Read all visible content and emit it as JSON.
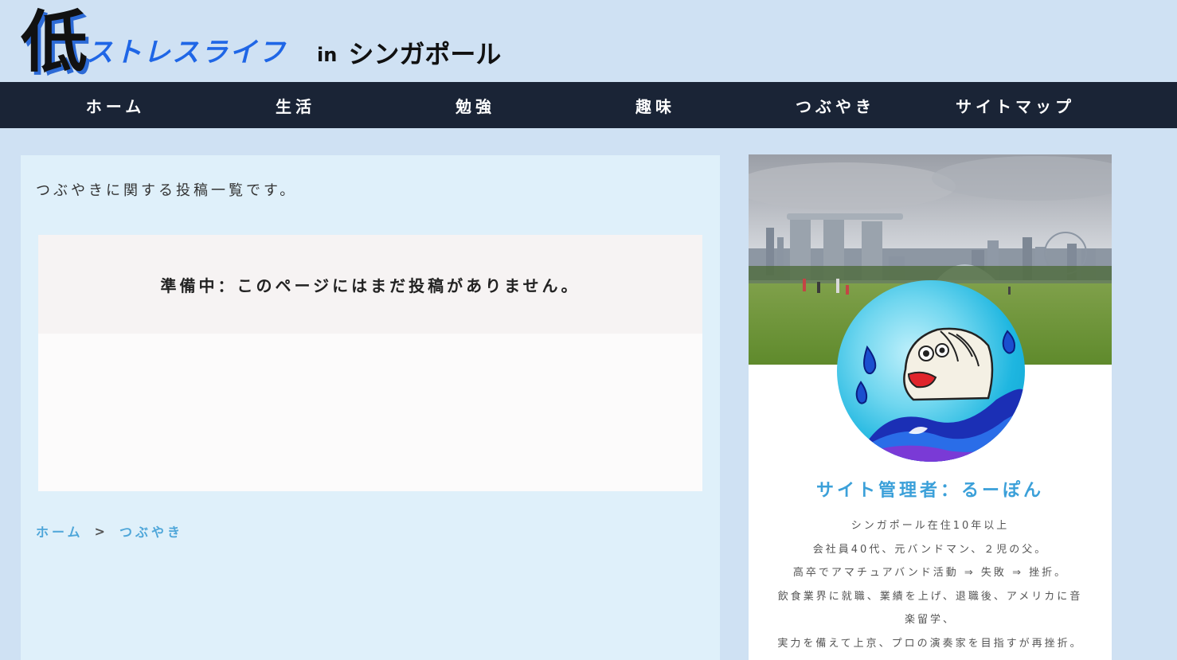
{
  "site": {
    "logo_kanji": "低",
    "logo_main": "ストレスライフ",
    "logo_in": "in",
    "logo_place": "シンガポール"
  },
  "nav": {
    "items": [
      "ホーム",
      "生活",
      "勉強",
      "趣味",
      "つぶやき",
      "サイトマップ"
    ]
  },
  "main": {
    "intro": "つぶやきに関する投稿一覧です。",
    "notice": "準備中：このページにはまだ投稿がありません。"
  },
  "breadcrumb": {
    "home": "ホーム",
    "sep": ">",
    "current": "つぶやき"
  },
  "sidebar": {
    "admin_name": "サイト管理者：るーぽん",
    "bio": [
      "シンガポール在住10年以上",
      "会社員40代、元バンドマン、２児の父。",
      "高卒でアマチュアバンド活動 ⇒ 失敗 ⇒ 挫折。",
      "飲食業界に就職、業績を上げ、退職後、アメリカに音",
      "楽留学、",
      "実力を備えて上京、プロの演奏家を目指すが再挫折。"
    ]
  },
  "colors": {
    "background": "#cfe1f3",
    "nav_bg": "#1a2436",
    "logo_blue": "#1f66e6",
    "accent_blue": "#3ba0d9",
    "main_bg": "#dff0fa"
  }
}
